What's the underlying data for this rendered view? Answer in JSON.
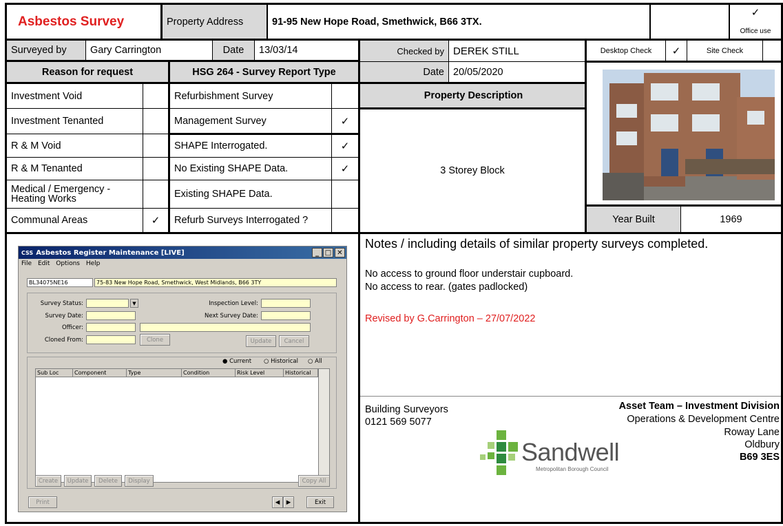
{
  "header": {
    "title": "Asbestos Survey",
    "address_label": "Property Address",
    "address": "91-95 New Hope Road, Smethwick, B66 3TX.",
    "office_tick": "✓",
    "office_use": "Office use"
  },
  "survey_info": {
    "surveyed_by_label": "Surveyed by",
    "surveyed_by": "Gary Carrington",
    "date_label": "Date",
    "date": "13/03/14",
    "checked_by_label": "Checked by",
    "checked_by": "DEREK STILL",
    "desktop_check_label": "Desktop Check",
    "desktop_check_tick": "✓",
    "site_check_label": "Site Check",
    "check_date_label": "Date",
    "check_date": "20/05/2020"
  },
  "reason": {
    "heading": "Reason for request",
    "items": [
      {
        "label": "Investment Void",
        "tick": ""
      },
      {
        "label": "Investment Tenanted",
        "tick": ""
      },
      {
        "label": "R & M Void",
        "tick": ""
      },
      {
        "label": "R & M Tenanted",
        "tick": ""
      },
      {
        "label": "Medical / Emergency - Heating Works",
        "tick": ""
      },
      {
        "label": "Communal Areas",
        "tick": "✓"
      }
    ]
  },
  "hsg": {
    "heading": "HSG 264 - Survey Report Type",
    "items": [
      {
        "label": "Refurbishment Survey",
        "tick": ""
      },
      {
        "label": "Management Survey",
        "tick": "✓"
      },
      {
        "label": "SHAPE Interrogated.",
        "tick": "✓"
      },
      {
        "label": "No Existing SHAPE Data.",
        "tick": "✓"
      },
      {
        "label": "Existing SHAPE Data.",
        "tick": ""
      },
      {
        "label": "Refurb Surveys Interrogated ?",
        "tick": ""
      }
    ]
  },
  "property": {
    "description_heading": "Property Description",
    "description": "3 Storey Block",
    "year_built_label": "Year Built",
    "year_built": "1969"
  },
  "notes": {
    "heading": "Notes / including details of similar property surveys completed.",
    "line1": "No access to ground floor understair cupboard.",
    "line2": "No access to rear. (gates padlocked)",
    "revised": "Revised by G.Carrington – 27/07/2022",
    "revised_color": "#e02020"
  },
  "footer": {
    "dept": "Building Surveyors",
    "phone": "0121 569 5077",
    "team": "Asset Team – Investment Division",
    "addr1": "Operations & Development Centre",
    "addr2": "Roway Lane",
    "addr3": "Oldbury",
    "postcode": "B69 3ES",
    "logo_name": "Sandwell",
    "logo_sub": "Metropolitan Borough Council"
  },
  "app_window": {
    "title": "Asbestos Register Maintenance [LIVE]",
    "title_prefix": "CSS",
    "menu": [
      "File",
      "Edit",
      "Options",
      "Help"
    ],
    "ref": "BL34075NE16",
    "address": "75-83 New Hope Road, Smethwick, West Midlands, B66 3TY",
    "labels": {
      "survey_status": "Survey Status:",
      "inspection_level": "Inspection Level:",
      "survey_date": "Survey Date:",
      "next_survey_date": "Next Survey Date:",
      "officer": "Officer:",
      "cloned_from": "Cloned From:"
    },
    "buttons": {
      "clone": "Clone",
      "update_top": "Update",
      "cancel": "Cancel",
      "create": "Create",
      "update": "Update",
      "delete": "Delete",
      "display": "Display",
      "copy_all": "Copy All",
      "print": "Print",
      "exit": "Exit"
    },
    "radios": {
      "current": "Current",
      "historical": "Historical",
      "all": "All"
    },
    "columns": [
      "Sub Loc",
      "Component",
      "Type",
      "Condition",
      "Risk Level",
      "Historical"
    ]
  }
}
